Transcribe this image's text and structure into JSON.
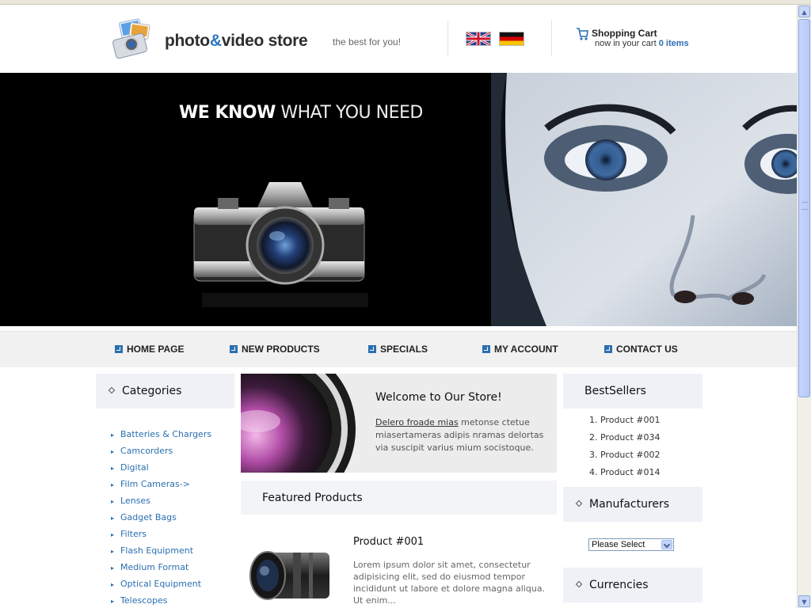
{
  "header": {
    "logo": {
      "brand_main": "photo",
      "brand_amp": "&",
      "brand_rest": "video store"
    },
    "tagline": "the best for you!",
    "languages": [
      {
        "name": "flag-uk-icon"
      },
      {
        "name": "flag-de-icon"
      }
    ],
    "cart": {
      "title": "Shopping Cart",
      "sub_prefix": "now in your cart",
      "items": "0 items"
    }
  },
  "banner": {
    "title_bold": "WE KNOW",
    "title_rest": "WHAT YOU NEED"
  },
  "nav": {
    "items": [
      "HOME PAGE",
      "NEW PRODUCTS",
      "SPECIALS",
      "MY ACCOUNT",
      "CONTACT US"
    ]
  },
  "sidebar": {
    "categories_title": "Categories",
    "categories": [
      "Batteries & Chargers",
      "Camcorders",
      "Digital",
      "Film Cameras->",
      "Lenses",
      "Gadget Bags",
      "Filters",
      "Flash Equipment",
      "Medium Format",
      "Optical Equipment",
      "Telescopes"
    ]
  },
  "main": {
    "welcome_title": "Welcome to Our Store!",
    "welcome_link": "Delero froade mias",
    "welcome_text": " metonse ctetue miasertameras adipis nramas delortas via suscipit varius mium socistoque.",
    "featured_title": "Featured Products",
    "product": {
      "title": "Product #001",
      "desc": "Lorem ipsum dolor sit amet, consectetur adipisicing elit, sed do eiusmod tempor incididunt ut labore et dolore magna aliqua. Ut enim..."
    }
  },
  "right": {
    "bestsellers_title": "BestSellers",
    "bestsellers": [
      "1. Product #001",
      "2. Product #034",
      "3. Product #002",
      "4. Product #014"
    ],
    "manufacturers_title": "Manufacturers",
    "manufacturers_select": "Please Select",
    "currencies_title": "Currencies"
  },
  "colors": {
    "accent": "#2a6fb0",
    "nav_bg": "#f1f1f1",
    "box_bg": "#eff1f6"
  }
}
